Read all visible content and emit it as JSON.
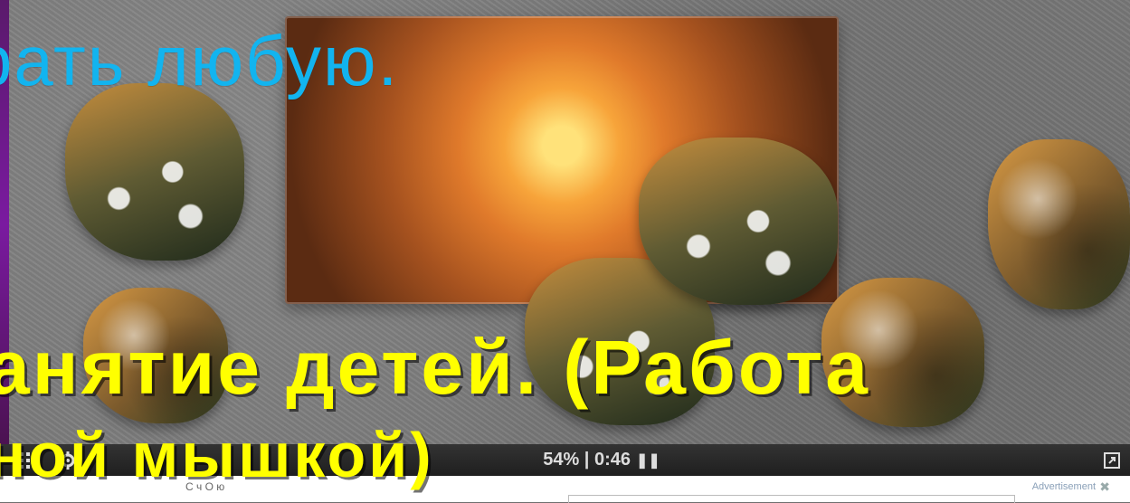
{
  "overlay": {
    "top_text": "рать любую.",
    "middle_text": "анятие детей. (Работа",
    "bottom_text": "ной мышкой)"
  },
  "controls": {
    "progress_percent": "54%",
    "timer": "0:46",
    "grid_icon": "grid-icon",
    "settings_icon": "gear-icon",
    "pause_icon": "pause-icon",
    "fullscreen_icon": "expand-icon"
  },
  "footer": {
    "advertisement_label": "Advertisement",
    "small_label": "С   ч   О  ю"
  },
  "colors": {
    "overlay_blue": "#12b4ef",
    "overlay_yellow": "#ffff00",
    "controlbar_bg": "#2a2a2a"
  }
}
